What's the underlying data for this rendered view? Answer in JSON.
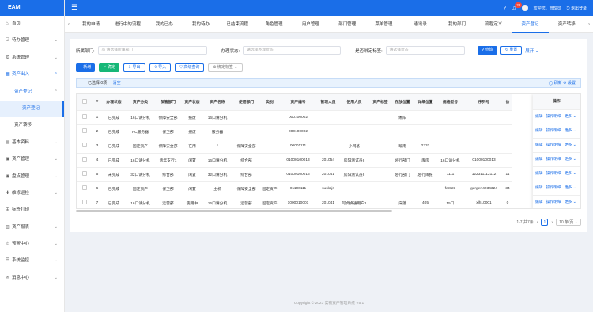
{
  "app": {
    "logo": "EAM"
  },
  "sidebar": {
    "items": [
      {
        "icon": "⌂",
        "label": "首页",
        "level": 0,
        "state": ""
      },
      {
        "icon": "☑",
        "label": "待办管理",
        "level": 0,
        "state": "",
        "arrow": "⌄"
      },
      {
        "icon": "⚙",
        "label": "系统管理",
        "level": 0,
        "state": "",
        "arrow": "⌄"
      },
      {
        "icon": "▦",
        "label": "资产出入",
        "level": 0,
        "state": "open",
        "arrow": "⌃"
      },
      {
        "icon": "",
        "label": "资产登记",
        "level": 1,
        "state": "active",
        "arrow": "⌃"
      },
      {
        "icon": "",
        "label": "资产登记",
        "level": 2,
        "state": "selected"
      },
      {
        "icon": "",
        "label": "资产转移",
        "level": 1,
        "state": ""
      },
      {
        "icon": "▤",
        "label": "基本资料",
        "level": 0,
        "state": "",
        "arrow": "⌄"
      },
      {
        "icon": "▣",
        "label": "资产管理",
        "level": 0,
        "state": "",
        "arrow": "⌄"
      },
      {
        "icon": "◉",
        "label": "盘点管理",
        "level": 0,
        "state": "",
        "arrow": "⌄"
      },
      {
        "icon": "✚",
        "label": "维修巡检",
        "level": 0,
        "state": "",
        "arrow": "⌄"
      },
      {
        "icon": "⊞",
        "label": "标签打印",
        "level": 0,
        "state": ""
      },
      {
        "icon": "▥",
        "label": "资产报表",
        "level": 0,
        "state": "",
        "arrow": "⌄"
      },
      {
        "icon": "⚠",
        "label": "预警中心",
        "level": 0,
        "state": "",
        "arrow": "⌄"
      },
      {
        "icon": "☰",
        "label": "系统监控",
        "level": 0,
        "state": "",
        "arrow": "⌄"
      },
      {
        "icon": "✉",
        "label": "消息中心",
        "level": 0,
        "state": "",
        "arrow": "⌄"
      }
    ]
  },
  "topbar": {
    "menu_icon": "☰",
    "search_icon": "⚲",
    "bell_icon": "♫",
    "badge": "22",
    "welcome": "欢迎您，管理员",
    "logout": "⎋ 退出登录"
  },
  "tabs": {
    "prev": "‹",
    "next": "›",
    "items": [
      {
        "label": "我的申请",
        "active": false
      },
      {
        "label": "进行中的流程",
        "active": false
      },
      {
        "label": "我的已办",
        "active": false
      },
      {
        "label": "我的待办",
        "active": false
      },
      {
        "label": "已结束流程",
        "active": false
      },
      {
        "label": "角色管理",
        "active": false
      },
      {
        "label": "用户管理",
        "active": false
      },
      {
        "label": "部门管理",
        "active": false
      },
      {
        "label": "菜单管理",
        "active": false
      },
      {
        "label": "通讯录",
        "active": false
      },
      {
        "label": "我的部门",
        "active": false
      },
      {
        "label": "流程定义",
        "active": false
      },
      {
        "label": "资产登记",
        "active": true
      },
      {
        "label": "资产转移",
        "active": false
      }
    ]
  },
  "filters": {
    "dept_label": "所属部门:",
    "dept_placeholder": "品 请选择所属部门",
    "status_label": "办理状态:",
    "status_placeholder": "请选择办理状态",
    "tag_label": "是否绑定标签:",
    "tag_placeholder": "请选择状态",
    "search": "⚲ 查询",
    "reset": "↻ 重置",
    "expand": "展开 ⌄"
  },
  "toolbar": {
    "add": "+ 新增",
    "confirm": "✓ 确定",
    "export": "⇩ 导出",
    "import": "⇧ 导入",
    "advanced": "▽ 高级查询",
    "bind_tag": "⊕ 绑定标签 ⌄"
  },
  "selection": {
    "text": "已选择 0项",
    "clear": "清空",
    "refresh": "◯ 刷新",
    "settings": "⚙ 设置"
  },
  "table": {
    "columns": [
      "",
      "#",
      "办理状态",
      "资产分类",
      "保管部门",
      "资产状态",
      "资产名称",
      "使用部门",
      "类别",
      "资产编号",
      "管理人员",
      "使用人员",
      "资产标签",
      "存放位置",
      "详细位置",
      "规格型号",
      "序列号",
      "价"
    ],
    "rows": [
      [
        "",
        "1",
        "已完成",
        "16口请分机",
        "保障安全部",
        "报废",
        "16口请分机",
        "",
        "",
        "000100002",
        "",
        "",
        "",
        "绑阳",
        "",
        "",
        "",
        ""
      ],
      [
        "",
        "2",
        "已完成",
        "FC服务器",
        "保卫部",
        "报废",
        "服务器",
        "",
        "",
        "000100002",
        "",
        "",
        "",
        "",
        "",
        "",
        "",
        ""
      ],
      [
        "",
        "3",
        "已完成",
        "固定资产",
        "保障安全部",
        "在用",
        "1",
        "保障安全部",
        "",
        "00001111",
        "",
        "小网基",
        "",
        "瑜南",
        "2331",
        "",
        "",
        ""
      ],
      [
        "",
        "4",
        "已完成",
        "16口请分机",
        "青年支行1",
        "闲置",
        "16口请分机",
        "综合部",
        "",
        "01000100013",
        "201054",
        "房阳测试员6",
        "",
        "总行部门",
        "库房",
        "16口请分机",
        "01000100013",
        ""
      ],
      [
        "",
        "5",
        "未完成",
        "32口请分机",
        "综合部",
        "闲置",
        "32口请分机",
        "综合部",
        "",
        "01000100016",
        "201041",
        "房阳测试员6",
        "",
        "总行部门",
        "总行库报",
        "1111",
        "122311112112",
        "11"
      ],
      [
        "",
        "6",
        "已完成",
        "固定资产",
        "保卫部",
        "闲置",
        "主机",
        "保障安全部",
        "固定资产",
        "01100111",
        "susksjs",
        "",
        "",
        "",
        "",
        "fer323",
        "gergert4234324",
        "34"
      ],
      [
        "",
        "7",
        "已完成",
        "16口请分机",
        "运营部",
        "使用中",
        "16口请分机",
        "运营部",
        "固定资产",
        "1000010001",
        "201041",
        "阿贞换通用户1",
        "",
        "床蓬",
        "405",
        "15口",
        "xlh10001",
        "0"
      ]
    ],
    "op_header": "操作",
    "op_edit": "编辑",
    "op_detail": "操作明细",
    "op_more": "更多 ⌄"
  },
  "pager": {
    "summary": "1-7 共7条",
    "prev": "‹",
    "page": "1",
    "next": "›",
    "size": "10 条/页 ⌄"
  },
  "footer": "Copyright © 2023 实物资产管理系统 V5.1"
}
